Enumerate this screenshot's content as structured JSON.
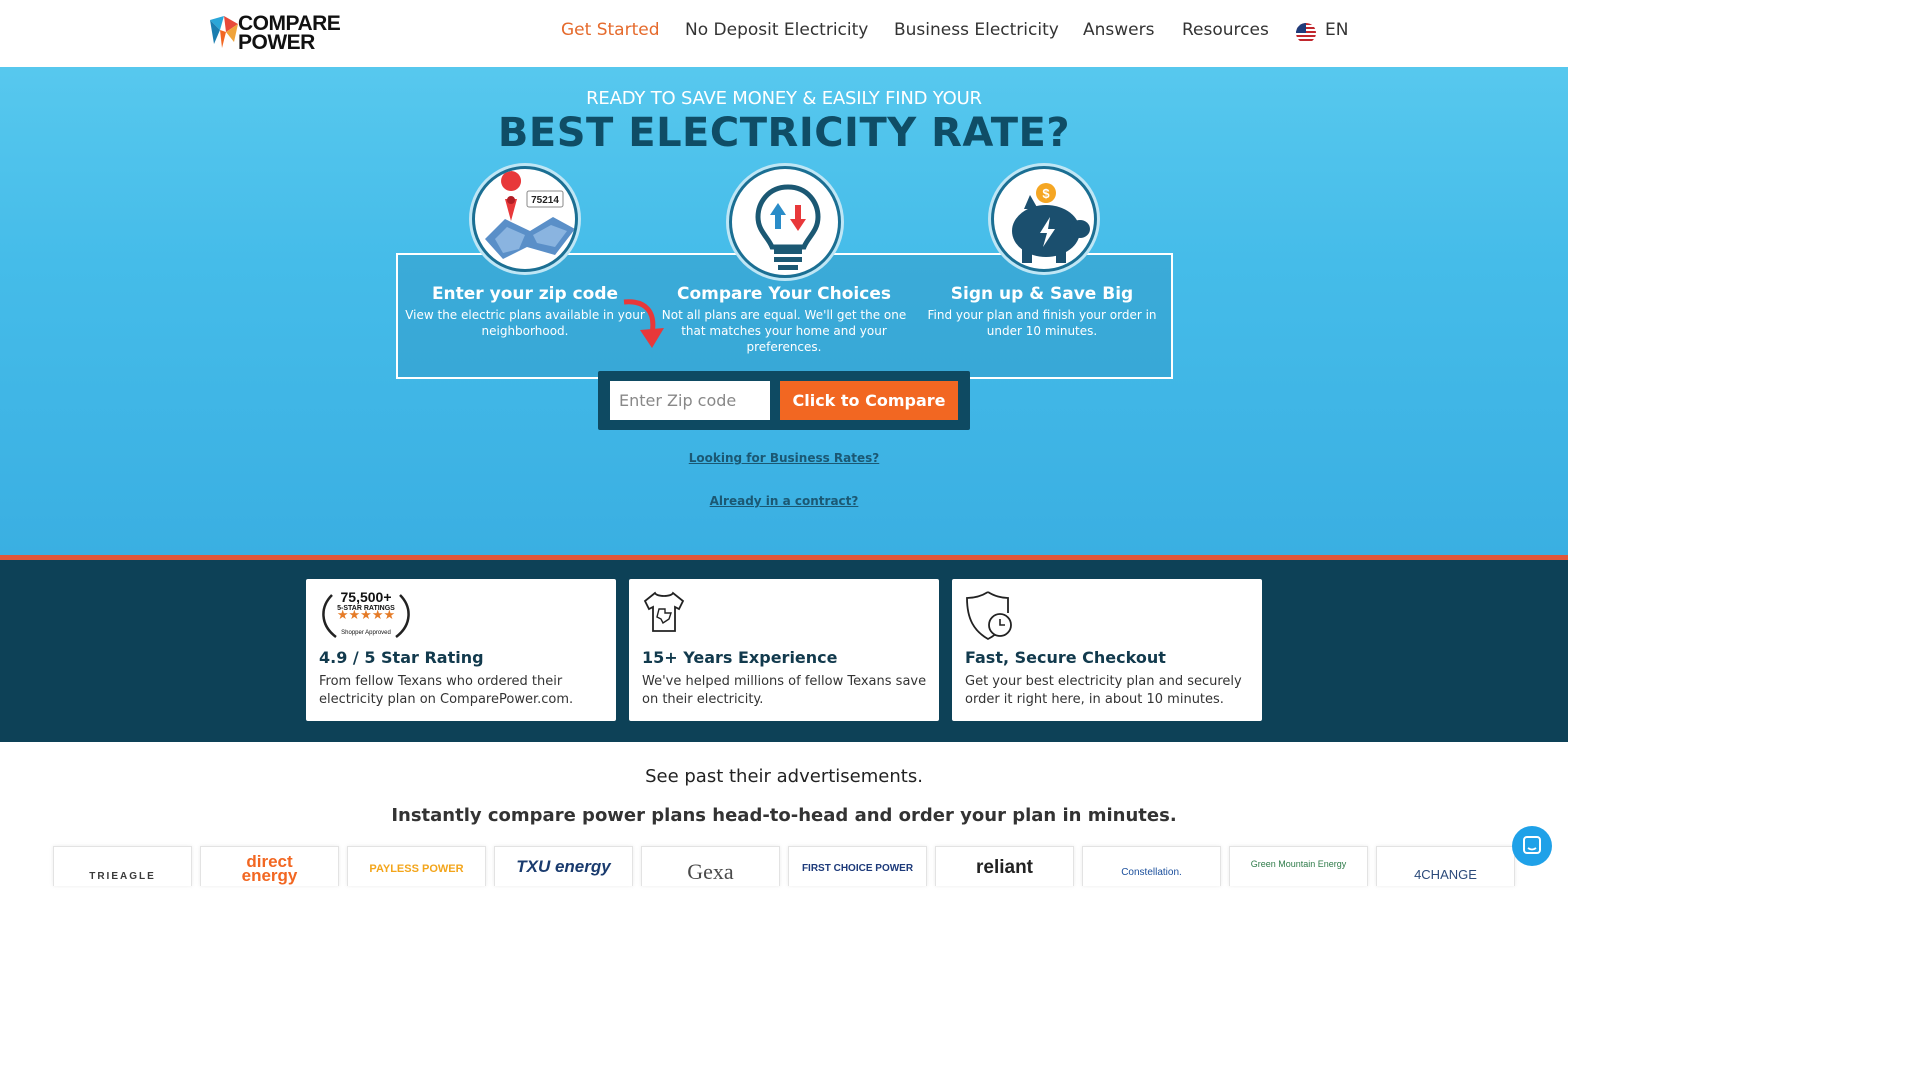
{
  "header": {
    "logo_text_line1": "COMPARE",
    "logo_text_line2": "POWER",
    "nav": [
      {
        "label": "Get Started",
        "active": true
      },
      {
        "label": "No Deposit Electricity"
      },
      {
        "label": "Business Electricity"
      },
      {
        "label": "Answers"
      },
      {
        "label": "Resources"
      }
    ],
    "language": "EN"
  },
  "hero": {
    "kicker": "READY TO SAVE MONEY & EASILY FIND YOUR",
    "headline": "BEST ELECTRICITY RATE?",
    "map_zip_badge": "75214",
    "steps": [
      {
        "title": "Enter your zip code",
        "text": "View the electric plans available in your neighborhood."
      },
      {
        "title": "Compare Your Choices",
        "text": "Not all plans are equal. We'll get the one that matches your home and your preferences."
      },
      {
        "title": "Sign up & Save Big",
        "text": "Find your plan and finish your order in under 10 minutes."
      }
    ],
    "zip_placeholder": "Enter Zip code",
    "compare_button": "Click to Compare",
    "business_link": "Looking for Business Rates?",
    "contract_link": "Already in a contract?"
  },
  "trust": {
    "rating_badge": {
      "count": "75,500+",
      "subtitle": "5-STAR RATINGS",
      "approved": "Shopper Approved"
    },
    "cards": [
      {
        "title": "4.9 / 5 Star Rating",
        "text": "From fellow Texans who ordered their electricity plan on ComparePower.com."
      },
      {
        "title": "15+ Years Experience",
        "text": "We've helped millions of fellow Texans save on their electricity."
      },
      {
        "title": "Fast, Secure Checkout",
        "text": "Get your best electricity plan and securely order it right here, in about 10 minutes."
      }
    ]
  },
  "bottom": {
    "tagline": "See past their advertisements.",
    "subtagline": "Instantly compare power plans head-to-head and order your plan in minutes."
  },
  "providers": [
    {
      "name": "TRIEAGLE",
      "color": "#3a3a3a"
    },
    {
      "name": "direct energy",
      "color": "#f26722"
    },
    {
      "name": "PAYLESS POWER",
      "color": "#f3a51b"
    },
    {
      "name": "TXU energy",
      "color": "#1a3b6e"
    },
    {
      "name": "Gexa",
      "color": "#4a4a4a"
    },
    {
      "name": "FIRST CHOICE POWER",
      "color": "#1d3a7a"
    },
    {
      "name": "reliant",
      "color": "#222222"
    },
    {
      "name": "Constellation.",
      "color": "#1b4f9c"
    },
    {
      "name": "Green Mountain Energy",
      "color": "#2f7c4a"
    },
    {
      "name": "4CHANGE",
      "color": "#2b4a7a"
    }
  ],
  "colors": {
    "accent_orange": "#f26722",
    "hero_blue": "#45bce9",
    "navy": "#0d4157",
    "headline_navy": "#0f4d66"
  }
}
